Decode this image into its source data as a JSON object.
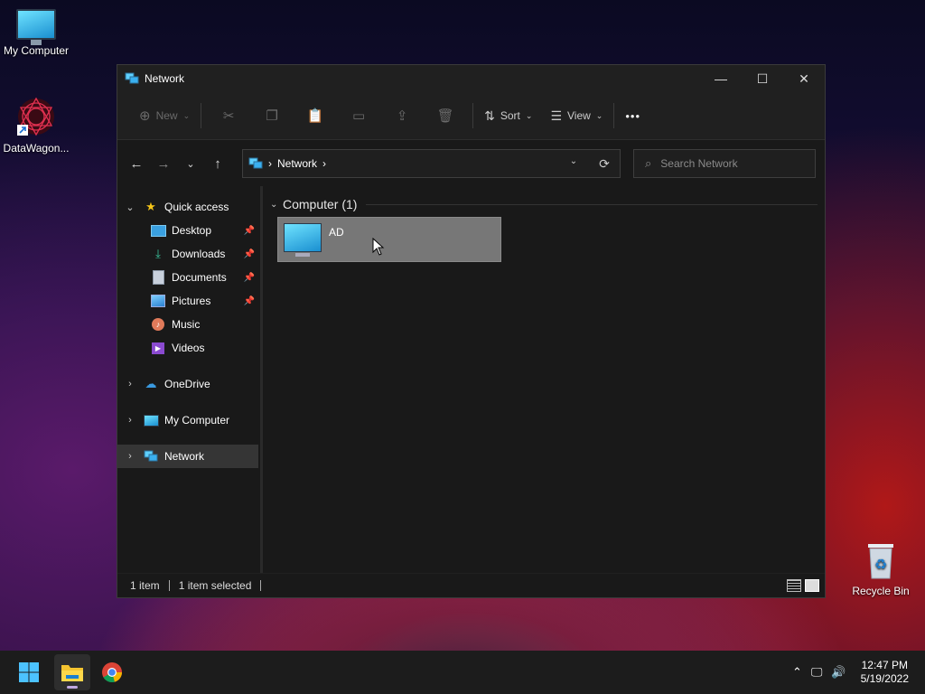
{
  "desktop": {
    "icons": [
      {
        "label": "My Computer"
      },
      {
        "label": "DataWagon..."
      },
      {
        "label": "Recycle Bin"
      }
    ]
  },
  "window": {
    "title": "Network",
    "controls": {
      "minimize": "—",
      "maximize": "☐",
      "close": "✕"
    }
  },
  "toolbar": {
    "new_label": "New",
    "sort_label": "Sort",
    "view_label": "View",
    "more_label": "•••"
  },
  "address": {
    "crumb": "Network",
    "sep1": "›",
    "sep2": "›"
  },
  "search": {
    "placeholder": "Search Network"
  },
  "sidebar": {
    "items": [
      {
        "label": "Quick access"
      },
      {
        "label": "Desktop"
      },
      {
        "label": "Downloads"
      },
      {
        "label": "Documents"
      },
      {
        "label": "Pictures"
      },
      {
        "label": "Music"
      },
      {
        "label": "Videos"
      },
      {
        "label": "OneDrive"
      },
      {
        "label": "My Computer"
      },
      {
        "label": "Network"
      }
    ]
  },
  "content": {
    "group_title": "Computer (1)",
    "items": [
      {
        "name": "AD"
      }
    ]
  },
  "status": {
    "count": "1 item",
    "selected": "1 item selected"
  },
  "taskbar": {
    "time": "12:47 PM",
    "date": "5/19/2022"
  },
  "colors": {
    "window_bg": "#202020",
    "selection": "#777777",
    "accent": "#0078d4"
  }
}
